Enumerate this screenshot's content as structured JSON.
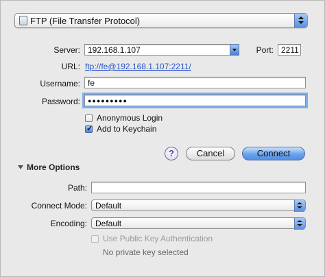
{
  "protocol": {
    "selected": "FTP (File Transfer Protocol)"
  },
  "server": {
    "label": "Server:",
    "value": "192.168.1.107"
  },
  "port": {
    "label": "Port:",
    "value": "2211"
  },
  "url": {
    "label": "URL:",
    "value": "ftp://fe@192.168.1.107:2211/"
  },
  "username": {
    "label": "Username:",
    "value": "fe"
  },
  "password": {
    "label": "Password:",
    "value": "●●●●●●●●●"
  },
  "options": {
    "anonymous": {
      "label": "Anonymous Login",
      "checked": false
    },
    "keychain": {
      "label": "Add to Keychain",
      "checked": true
    }
  },
  "buttons": {
    "help": "?",
    "cancel": "Cancel",
    "connect": "Connect"
  },
  "more_options": {
    "title": "More Options",
    "path_label": "Path:",
    "path_value": "",
    "connect_mode_label": "Connect Mode:",
    "connect_mode_value": "Default",
    "encoding_label": "Encoding:",
    "encoding_value": "Default",
    "public_key_label": "Use Public Key Authentication",
    "private_key_status": "No private key selected"
  }
}
